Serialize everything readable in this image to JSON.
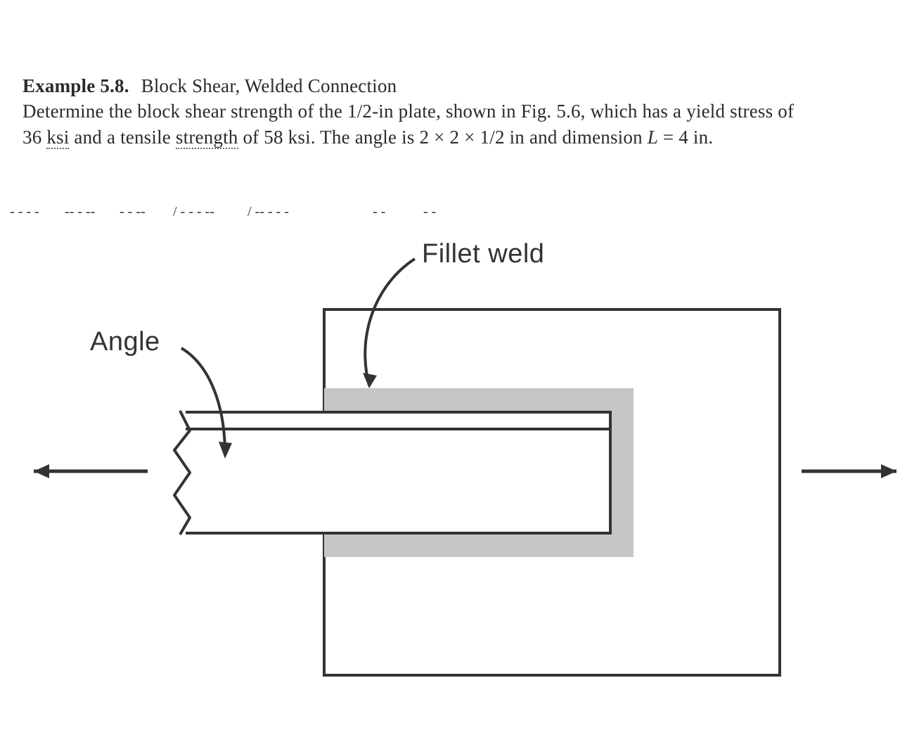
{
  "example": {
    "label": "Example 5.8.",
    "title": "Block Shear, Welded Connection",
    "body_line1": "Determine the block shear strength of the 1/2-in plate, shown in Fig. 5.6, which has a yield stress of",
    "body_line2_pre": "36 ",
    "body_line2_ksi": "ksi",
    "body_line2_mid": " and a tensile ",
    "body_line2_strength": "strength",
    "body_line2_post": " of 58 ksi. The angle is 2 × 2 × 1/2 in and dimension ",
    "body_line2_Lvar": "L",
    "body_line2_end": " = 4 in."
  },
  "labels": {
    "fillet_weld": "Fillet weld",
    "angle": "Angle"
  }
}
